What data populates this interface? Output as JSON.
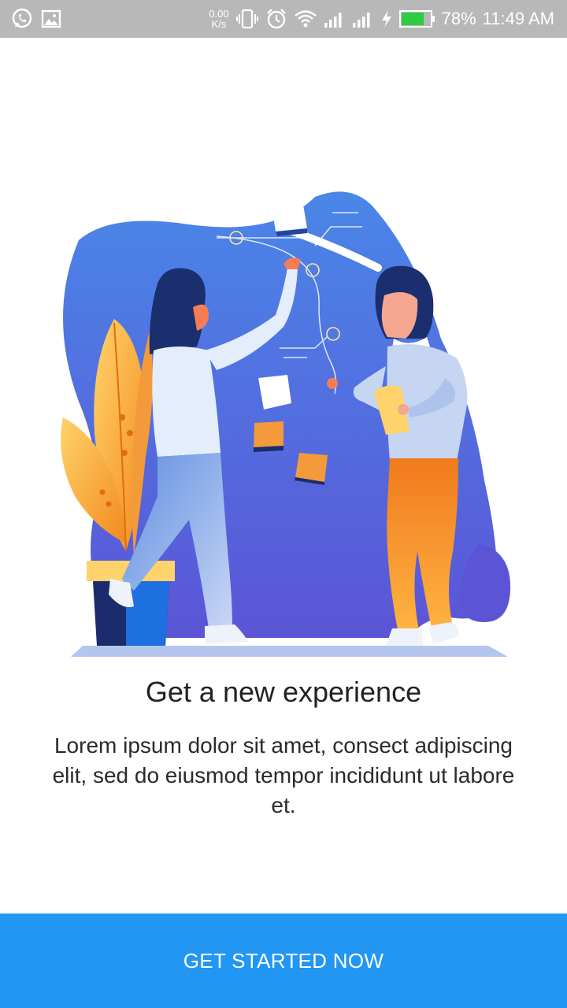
{
  "status_bar": {
    "net_speed_value": "0.00",
    "net_speed_unit": "K/s",
    "battery_percent": "78%",
    "time": "11:49 AM",
    "icons": [
      "whatsapp-icon",
      "image-icon",
      "vibrate-icon",
      "alarm-icon",
      "wifi-icon",
      "signal-icon",
      "signal-icon",
      "charging-icon",
      "battery-icon"
    ],
    "battery_level": 0.78,
    "battery_color": "#2ecc40"
  },
  "onboarding": {
    "illustration": "illustration-two-people-brainstorming",
    "title": "Get a new experience",
    "body": "Lorem ipsum dolor sit amet, consect adipiscing elit, sed do eiusmod tempor incididunt ut labore et."
  },
  "cta": {
    "label": "GET STARTED NOW",
    "color": "#2196f3"
  }
}
